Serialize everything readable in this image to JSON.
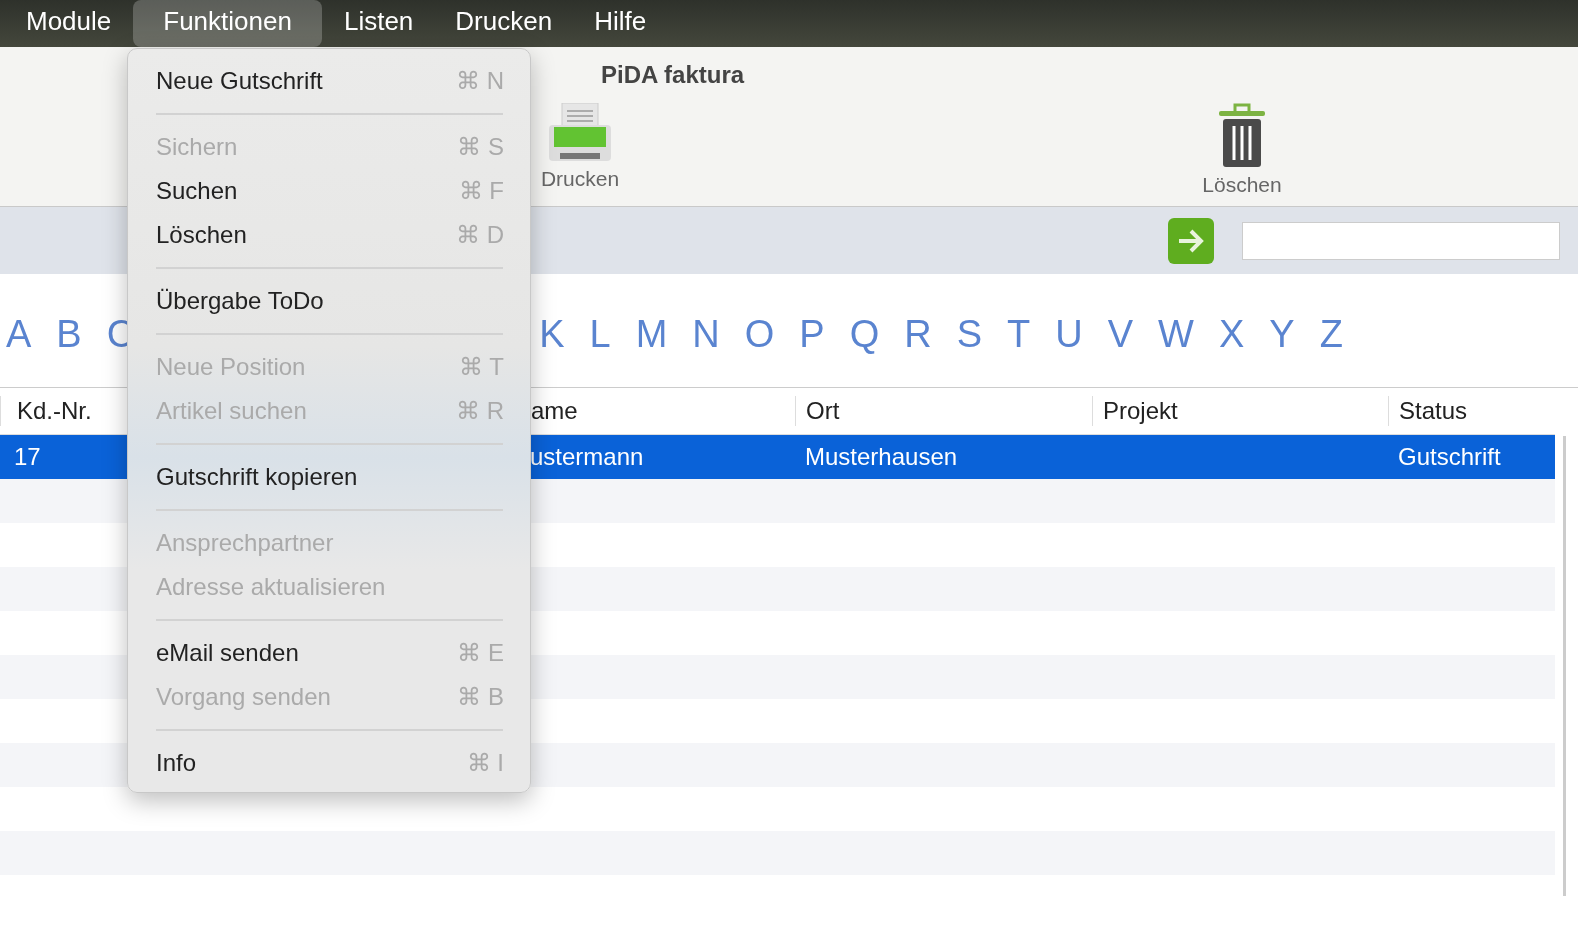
{
  "menubar": [
    {
      "label": "Module",
      "selected": false
    },
    {
      "label": "Funktionen",
      "selected": true
    },
    {
      "label": "Listen",
      "selected": false
    },
    {
      "label": "Drucken",
      "selected": false
    },
    {
      "label": "Hilfe",
      "selected": false
    }
  ],
  "window": {
    "title": "PiDA faktura"
  },
  "toolbar": [
    {
      "kind": "print",
      "label": "Drucken"
    },
    {
      "kind": "delete",
      "label": "Löschen"
    }
  ],
  "alphabet": [
    "A",
    "B",
    "C",
    "K",
    "L",
    "M",
    "N",
    "O",
    "P",
    "Q",
    "R",
    "S",
    "T",
    "U",
    "V",
    "W",
    "X",
    "Y",
    "Z"
  ],
  "table": {
    "columns": [
      "Kd.-Nr.",
      "ame",
      "Ort",
      "Projekt",
      "Status"
    ],
    "rows": [
      {
        "selected": true,
        "cells": [
          "17",
          "ustermann",
          "Musterhausen",
          "",
          "Gutschrift"
        ]
      }
    ]
  },
  "menu": [
    {
      "kind": "item",
      "label": "Neue Gutschrift",
      "shortcut": "⌘ N",
      "disabled": false
    },
    {
      "kind": "separator"
    },
    {
      "kind": "item",
      "label": "Sichern",
      "shortcut": "⌘ S",
      "disabled": true
    },
    {
      "kind": "item",
      "label": "Suchen",
      "shortcut": "⌘ F",
      "disabled": false
    },
    {
      "kind": "item",
      "label": "Löschen",
      "shortcut": "⌘ D",
      "disabled": false
    },
    {
      "kind": "separator"
    },
    {
      "kind": "item",
      "label": "Übergabe ToDo",
      "disabled": false
    },
    {
      "kind": "separator"
    },
    {
      "kind": "item",
      "label": "Neue Position",
      "shortcut": "⌘ T",
      "disabled": true
    },
    {
      "kind": "item",
      "label": "Artikel suchen",
      "shortcut": "⌘ R",
      "disabled": true
    },
    {
      "kind": "separator"
    },
    {
      "kind": "item",
      "label": "Gutschrift kopieren",
      "disabled": false
    },
    {
      "kind": "separator"
    },
    {
      "kind": "item",
      "label": "Ansprechpartner",
      "disabled": true
    },
    {
      "kind": "item",
      "label": "Adresse aktualisieren",
      "disabled": true
    },
    {
      "kind": "separator"
    },
    {
      "kind": "item",
      "label": "eMail senden",
      "shortcut": "⌘ E",
      "disabled": false
    },
    {
      "kind": "item",
      "label": "Vorgang senden",
      "shortcut": "⌘ B",
      "disabled": true
    },
    {
      "kind": "separator"
    },
    {
      "kind": "item",
      "label": "Info",
      "shortcut": "⌘ I",
      "disabled": false
    }
  ]
}
